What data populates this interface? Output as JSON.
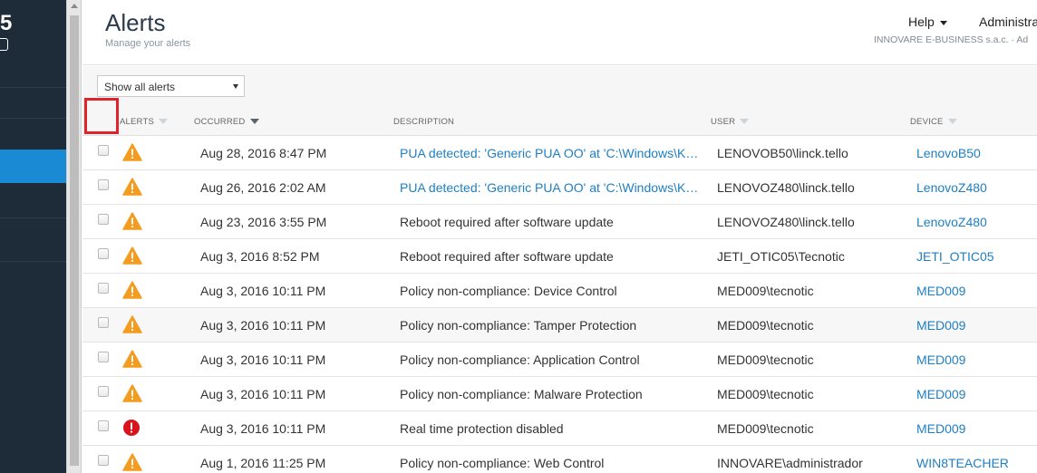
{
  "leftnav": {
    "logo_fragment": "5"
  },
  "header": {
    "title": "Alerts",
    "subtitle": "Manage your alerts",
    "help_label": "Help",
    "admin_label": "Administra",
    "org_name": "INNOVARE E-BUSINESS s.a.c. · Ad"
  },
  "filter": {
    "selected": "Show all alerts"
  },
  "columns": {
    "alerts": "ALERTS",
    "occurred": "OCCURRED",
    "description": "DESCRIPTION",
    "user": "USER",
    "device": "DEVICE"
  },
  "colors": {
    "warning": "#f39c1f",
    "error": "#d9141c",
    "link": "#1f7fc1",
    "nav_active": "#1a8ad4"
  },
  "alerts": [
    {
      "icon": "warning-icon",
      "occurred": "Aug 28, 2016 8:47 PM",
      "description": "PUA detected: 'Generic PUA OO' at 'C:\\Windows\\KM...",
      "description_link": true,
      "user": "LENOVOB50\\linck.tello",
      "device": "LenovoB50"
    },
    {
      "icon": "warning-icon",
      "occurred": "Aug 26, 2016 2:02 AM",
      "description": "PUA detected: 'Generic PUA OO' at 'C:\\Windows\\KM...",
      "description_link": true,
      "user": "LENOVOZ480\\linck.tello",
      "device": "LenovoZ480"
    },
    {
      "icon": "warning-icon",
      "occurred": "Aug 23, 2016 3:55 PM",
      "description": "Reboot required after software update",
      "description_link": false,
      "user": "LENOVOZ480\\linck.tello",
      "device": "LenovoZ480"
    },
    {
      "icon": "warning-icon",
      "occurred": "Aug 3, 2016 8:52 PM",
      "description": "Reboot required after software update",
      "description_link": false,
      "user": "JETI_OTIC05\\Tecnotic",
      "device": "JETI_OTIC05"
    },
    {
      "icon": "warning-icon",
      "occurred": "Aug 3, 2016 10:11 PM",
      "description": "Policy non-compliance: Device Control",
      "description_link": false,
      "user": "MED009\\tecnotic",
      "device": "MED009"
    },
    {
      "icon": "warning-icon",
      "occurred": "Aug 3, 2016 10:11 PM",
      "description": "Policy non-compliance: Tamper Protection",
      "description_link": false,
      "user": "MED009\\tecnotic",
      "device": "MED009"
    },
    {
      "icon": "warning-icon",
      "occurred": "Aug 3, 2016 10:11 PM",
      "description": "Policy non-compliance: Application Control",
      "description_link": false,
      "user": "MED009\\tecnotic",
      "device": "MED009"
    },
    {
      "icon": "warning-icon",
      "occurred": "Aug 3, 2016 10:11 PM",
      "description": "Policy non-compliance: Malware Protection",
      "description_link": false,
      "user": "MED009\\tecnotic",
      "device": "MED009"
    },
    {
      "icon": "error-icon",
      "occurred": "Aug 3, 2016 10:11 PM",
      "description": "Real time protection disabled",
      "description_link": false,
      "user": "MED009\\tecnotic",
      "device": "MED009"
    },
    {
      "icon": "warning-icon",
      "occurred": "Aug 1, 2016 11:25 PM",
      "description": "Policy non-compliance: Web Control",
      "description_link": false,
      "user": "INNOVARE\\administrador",
      "device": "WIN8TEACHER"
    }
  ]
}
